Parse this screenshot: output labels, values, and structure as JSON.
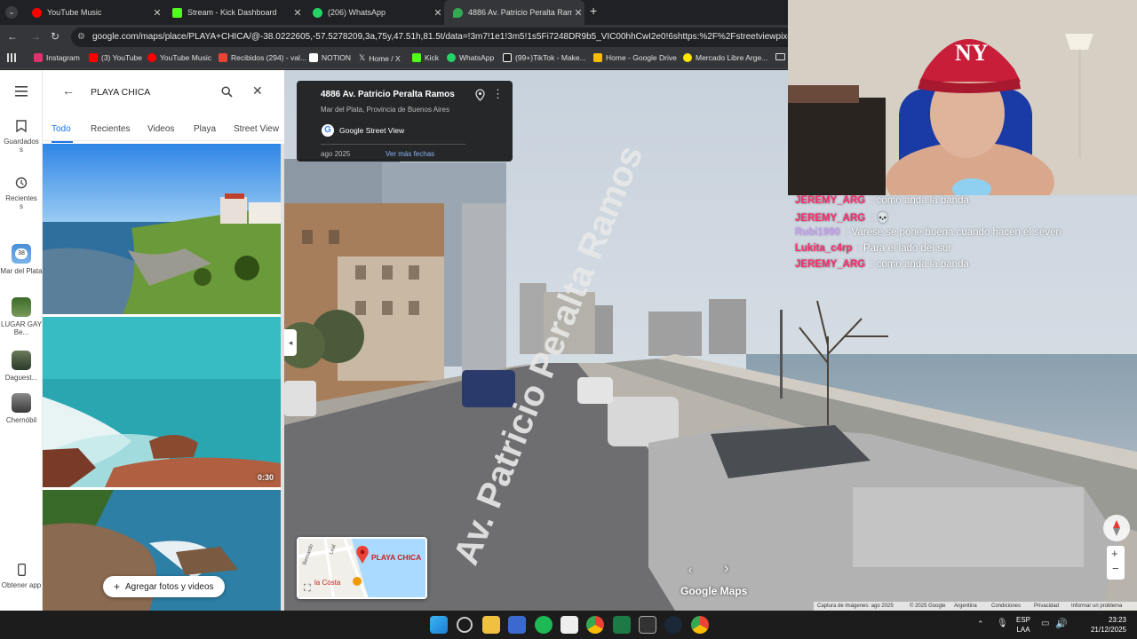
{
  "browser": {
    "tabs": [
      {
        "label": "YouTube Music",
        "color": "#ff0000"
      },
      {
        "label": "Stream - Kick Dashboard",
        "color": "#53fc18"
      },
      {
        "label": "(206) WhatsApp",
        "color": "#25d366"
      },
      {
        "label": "4886 Av. Patricio Peralta Ramos",
        "color": "#34a853"
      }
    ],
    "url": "google.com/maps/place/PLAYA+CHICA/@-38.0222605,-57.5278209,3a,75y,47.51h,81.5t/data=!3m7!1e1!3m5!1s5Fi7248DR9b5_VIC00hhCwI2e0!6shttps:%2F%2Fstreetviewpixels-pa.googleapis",
    "bookmarks": [
      {
        "label": "Instagram",
        "color": "#e1306c"
      },
      {
        "label": "(3) YouTube",
        "color": "#ff0000"
      },
      {
        "label": "YouTube Music",
        "color": "#ff0000"
      },
      {
        "label": "Recibidos (294) - val...",
        "color": "#ea4335"
      },
      {
        "label": "NOTION",
        "color": "#ffffff"
      },
      {
        "label": "Home / X",
        "color": "#ffffff"
      },
      {
        "label": "Kick",
        "color": "#53fc18"
      },
      {
        "label": "WhatsApp",
        "color": "#25d366"
      },
      {
        "label": "(99+)TikTok - Make...",
        "color": "#ffffff"
      },
      {
        "label": "Home - Google Drive",
        "color": "#fbbc04"
      },
      {
        "label": "Mercado Libre Arge...",
        "color": "#ffe600"
      }
    ]
  },
  "rail": {
    "saved": "Guardados",
    "recent": "Recientes",
    "places": [
      {
        "label": "Mar del Plata",
        "badge": "38"
      },
      {
        "label": "LUGAR GAY Be..."
      },
      {
        "label": "Daguest..."
      },
      {
        "label": "Chernóbil"
      }
    ],
    "get_app": "Obtener app"
  },
  "search": {
    "query": "PLAYA CHICA",
    "filters": [
      "Todo",
      "Recientes",
      "Videos",
      "Playa",
      "Street View"
    ],
    "video_duration": "0:30",
    "add_photos": "Agregar fotos y videos"
  },
  "streetview": {
    "address": "4886 Av. Patricio Peralta Ramos",
    "locality": "Mar del Plata, Provincia de Buenos Aires",
    "source": "Google Street View",
    "date": "ago 2025",
    "more_dates": "Ver más fechas",
    "minimap_label": "PLAYA CHICA",
    "minimap_street1": "Bernardo",
    "minimap_street2": "Leal",
    "minimap_place": "la Costa",
    "road_text": "Av. Patricio Peralta Ramos",
    "logo": "Google Maps",
    "footer": {
      "capture": "Captura de imágenes: ago 2025",
      "copyright": "© 2025 Google",
      "country": "Argentina",
      "terms": "Condiciones",
      "privacy": "Privacidad",
      "report": "Informar un problema"
    }
  },
  "chat": [
    {
      "user": "JEREMY_ARG",
      "color": "#ff2d6f",
      "text": ": como anda la banda"
    },
    {
      "user": "JEREMY_ARG",
      "color": "#ff2d6f",
      "text": ": 💀"
    },
    {
      "user": "Rubi1990",
      "color": "#c26bff",
      "text": ": Varese se pone buena cuando hacen el seven"
    },
    {
      "user": "Lukita_c4rp",
      "color": "#ff2d6f",
      "text": ": Para el lado del sur"
    },
    {
      "user": "JEREMY_ARG",
      "color": "#ff2d6f",
      "text": ": como anda la banda"
    }
  ],
  "taskbar": {
    "lang_top": "ESP",
    "lang_bottom": "LAA",
    "time": "23:23",
    "date": "21/12/2025"
  }
}
